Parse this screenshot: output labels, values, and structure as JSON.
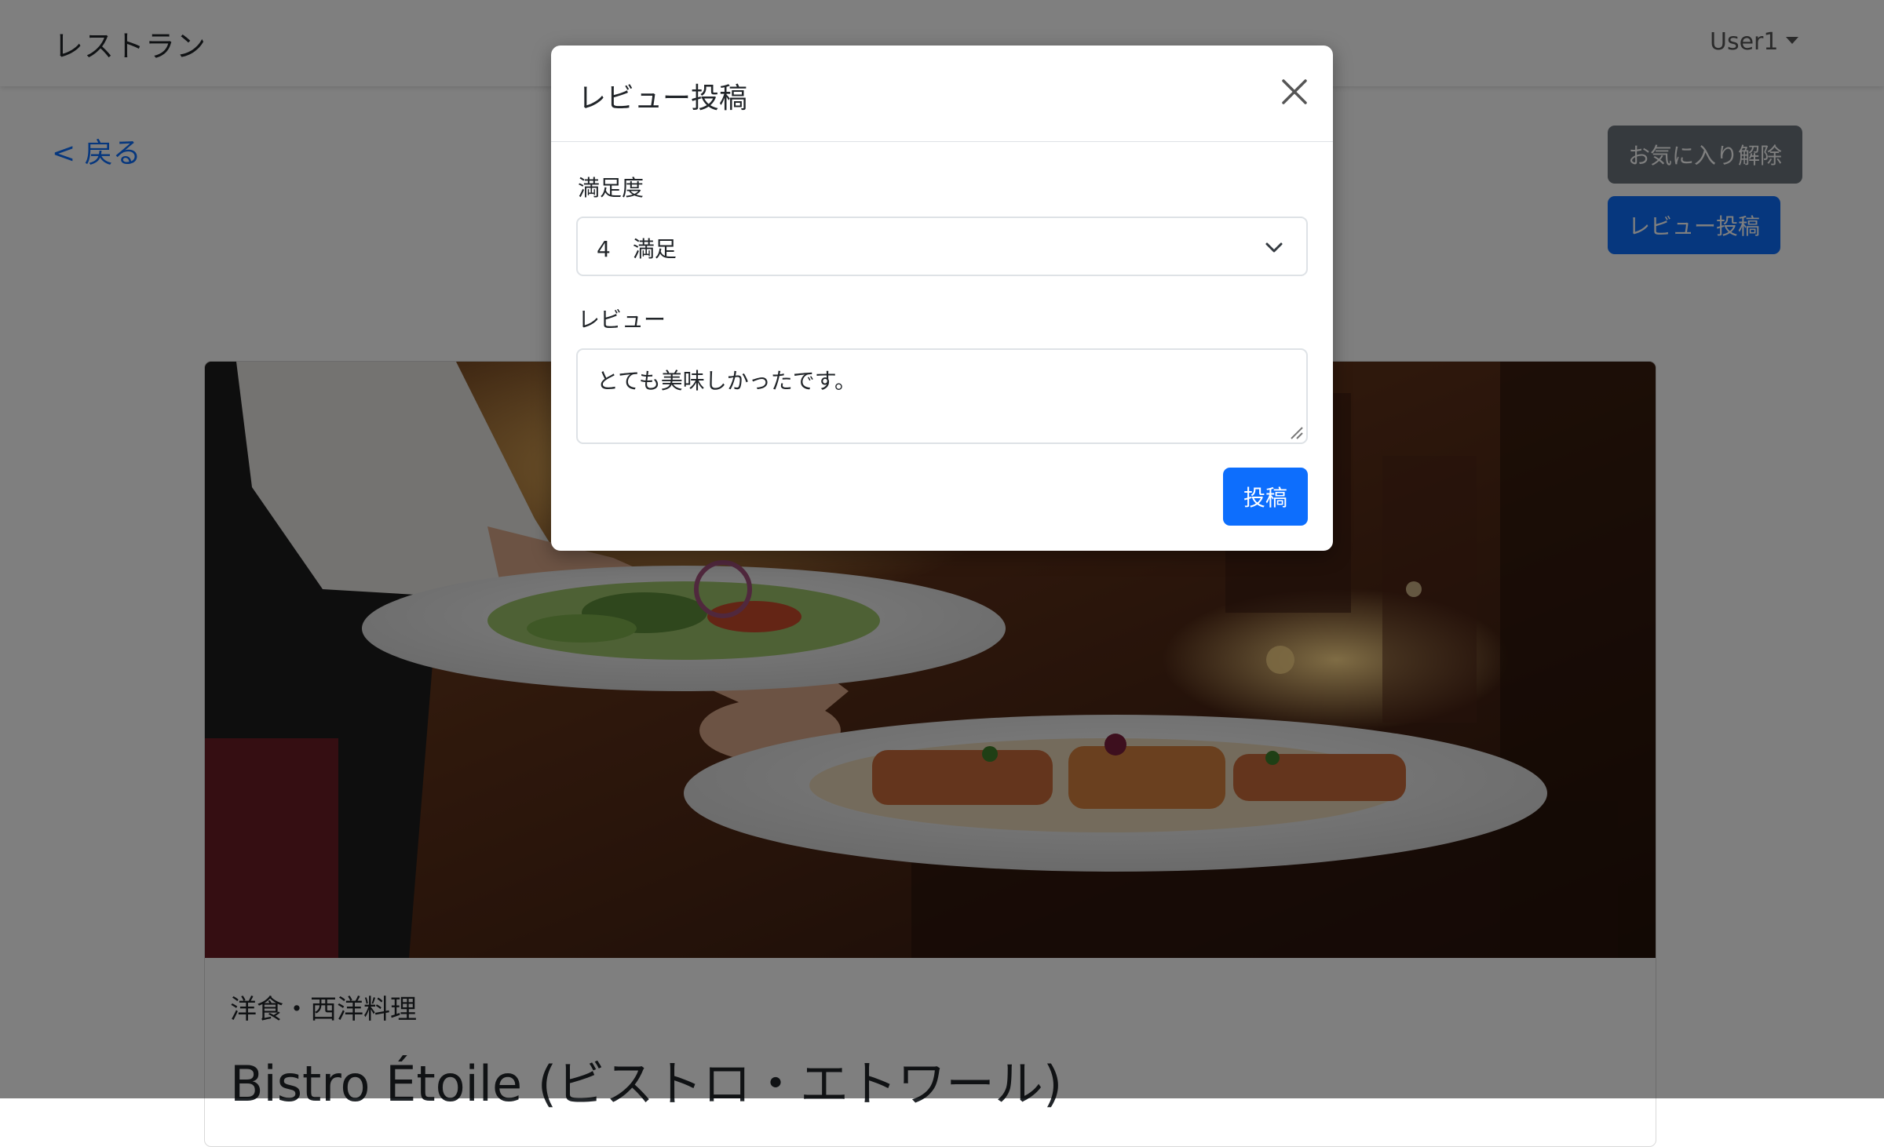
{
  "navbar": {
    "brand": "レストラン",
    "user": "User1"
  },
  "page": {
    "back_link": "< 戻る",
    "favorite_button": "お気に入り解除",
    "review_button": "レビュー投稿"
  },
  "restaurant": {
    "genre": "洋食・西洋料理",
    "name": "Bistro Étoile (ビストロ・エトワール)"
  },
  "modal": {
    "title": "レビュー投稿",
    "rating_label": "満足度",
    "rating_value": "4　満足",
    "review_label": "レビュー",
    "review_value": "とても美味しかったです。",
    "submit_button": "投稿"
  },
  "colors": {
    "primary": "#0d6efd",
    "secondary": "#6c757d",
    "backdrop": "rgba(0,0,0,0.5)"
  },
  "icons": {
    "close": "close-icon",
    "select": "chevron-down-icon",
    "dropdown": "caret-down-icon",
    "resize": "resize-grip-icon"
  }
}
